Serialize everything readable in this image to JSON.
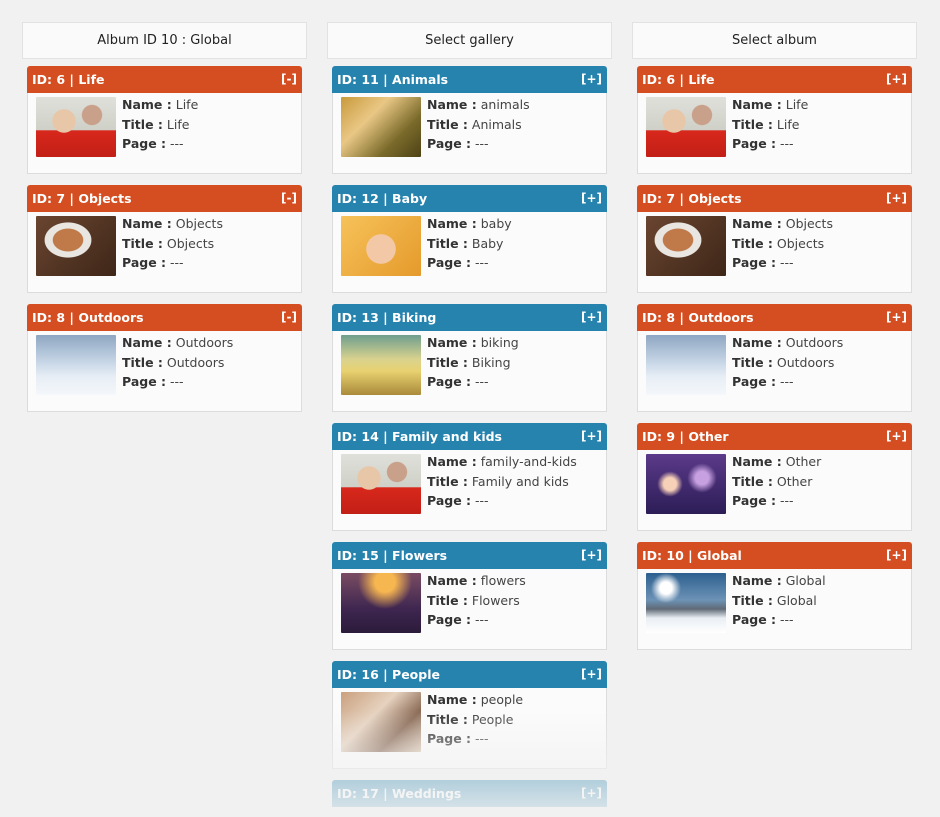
{
  "colors": {
    "album": "#d54e21",
    "gallery": "#2683ae",
    "background": "#f1f1f1"
  },
  "labels": {
    "name": "Name :",
    "title": "Title :",
    "page": "Page :"
  },
  "columns": [
    {
      "header": "Album ID 10 : Global",
      "items": [
        {
          "heading": "ID: 6 | Life",
          "toggle": "[-]",
          "name": "Life",
          "title": "Life",
          "page": "---",
          "thumb": "life"
        },
        {
          "heading": "ID: 7 | Objects",
          "toggle": "[-]",
          "name": "Objects",
          "title": "Objects",
          "page": "---",
          "thumb": "objects"
        },
        {
          "heading": "ID: 8 | Outdoors",
          "toggle": "[-]",
          "name": "Outdoors",
          "title": "Outdoors",
          "page": "---",
          "thumb": "outdoors"
        }
      ]
    },
    {
      "header": "Select gallery",
      "items": [
        {
          "heading": "ID: 11 | Animals",
          "toggle": "[+]",
          "name": "animals",
          "title": "Animals",
          "page": "---",
          "thumb": "animals"
        },
        {
          "heading": "ID: 12 | Baby",
          "toggle": "[+]",
          "name": "baby",
          "title": "Baby",
          "page": "---",
          "thumb": "baby"
        },
        {
          "heading": "ID: 13 | Biking",
          "toggle": "[+]",
          "name": "biking",
          "title": "Biking",
          "page": "---",
          "thumb": "biking"
        },
        {
          "heading": "ID: 14 | Family and kids",
          "toggle": "[+]",
          "name": "family-and-kids",
          "title": "Family and kids",
          "page": "---",
          "thumb": "family"
        },
        {
          "heading": "ID: 15 | Flowers",
          "toggle": "[+]",
          "name": "flowers",
          "title": "Flowers",
          "page": "---",
          "thumb": "flowers"
        },
        {
          "heading": "ID: 16 | People",
          "toggle": "[+]",
          "name": "people",
          "title": "People",
          "page": "---",
          "thumb": "people"
        },
        {
          "heading": "ID: 17 | Weddings",
          "toggle": "[+]"
        }
      ]
    },
    {
      "header": "Select album",
      "items": [
        {
          "heading": "ID: 6 | Life",
          "toggle": "[+]",
          "name": "Life",
          "title": "Life",
          "page": "---",
          "thumb": "life"
        },
        {
          "heading": "ID: 7 | Objects",
          "toggle": "[+]",
          "name": "Objects",
          "title": "Objects",
          "page": "---",
          "thumb": "objects"
        },
        {
          "heading": "ID: 8 | Outdoors",
          "toggle": "[+]",
          "name": "Outdoors",
          "title": "Outdoors",
          "page": "---",
          "thumb": "outdoors"
        },
        {
          "heading": "ID: 9 | Other",
          "toggle": "[+]",
          "name": "Other",
          "title": "Other",
          "page": "---",
          "thumb": "other"
        },
        {
          "heading": "ID: 10 | Global",
          "toggle": "[+]",
          "name": "Global",
          "title": "Global",
          "page": "---",
          "thumb": "global"
        }
      ]
    }
  ]
}
